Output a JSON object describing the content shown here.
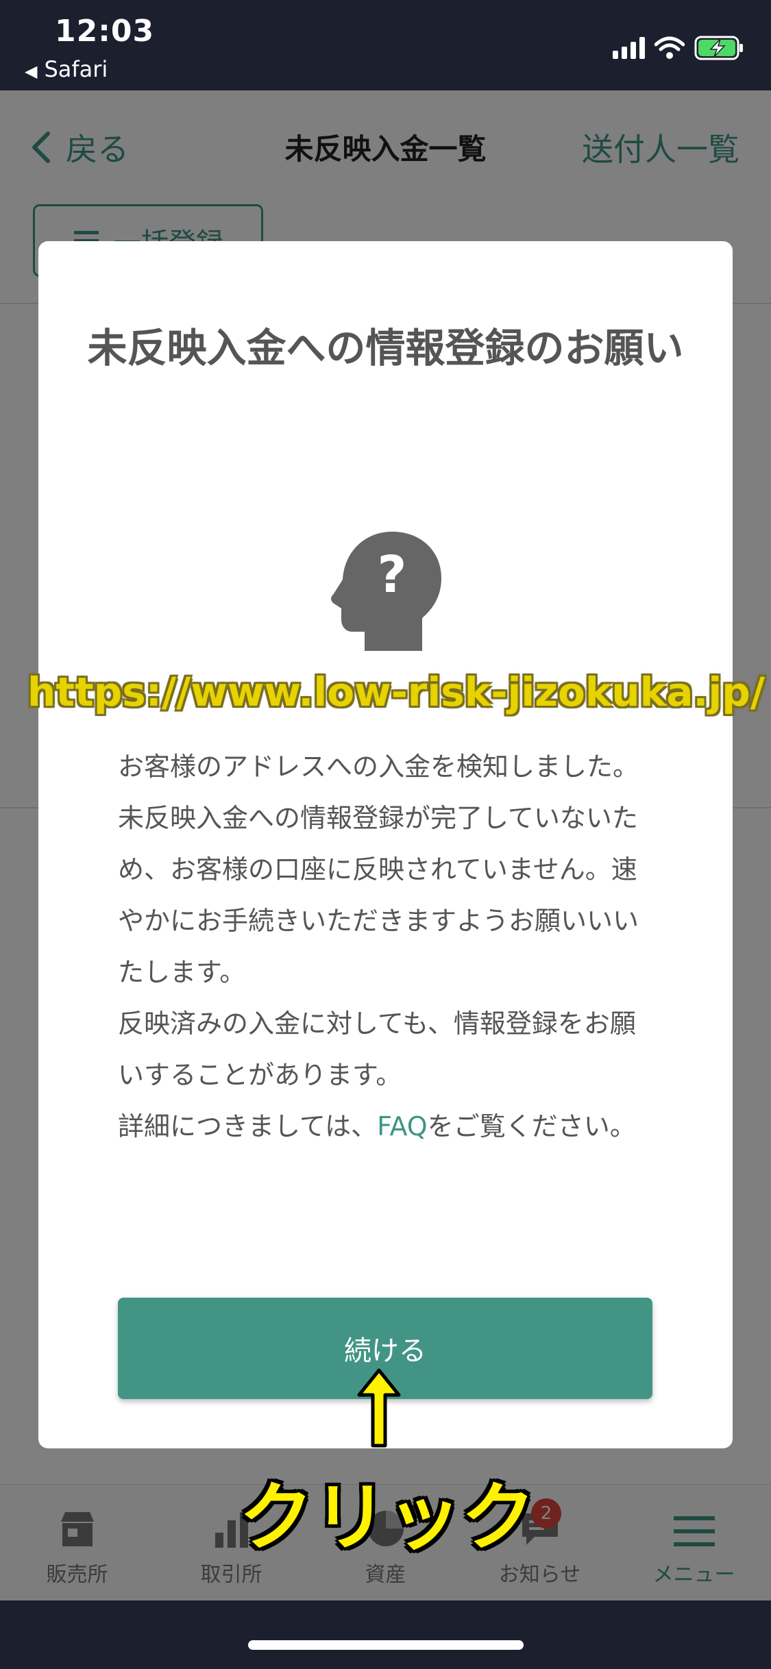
{
  "status_bar": {
    "time": "12:03",
    "back_app": "Safari",
    "back_glyph": "◀"
  },
  "nav": {
    "back_label": "戻る",
    "title": "未反映入金一覧",
    "right_label": "送付人一覧"
  },
  "bulk_register_button": {
    "label": "一括登録"
  },
  "modal": {
    "title": "未反映入金への情報登録のお願い",
    "icon": "head-question-icon",
    "body_paragraphs": [
      "お客様のアドレスへの入金を検知しました。",
      "未反映入金への情報登録が完了していないため、お客様の口座に反映されていません。速やかにお手続きいただきますようお願いいいたします。",
      "反映済みの入金に対しても、情報登録をお願いすることがあります。"
    ],
    "faq_prefix": "詳細につきましては、",
    "faq_link": "FAQ",
    "faq_suffix": "をご覧ください。",
    "continue_label": "続ける"
  },
  "tab_bar": {
    "items": [
      {
        "label": "販売所",
        "icon": "store-icon"
      },
      {
        "label": "取引所",
        "icon": "bar-chart-icon"
      },
      {
        "label": "資産",
        "icon": "pie-chart-icon"
      },
      {
        "label": "お知らせ",
        "icon": "chat-bubble-icon",
        "badge": "2"
      },
      {
        "label": "メニュー",
        "icon": "hamburger-menu-icon"
      }
    ]
  },
  "annotations": {
    "watermark_url": "https://www.low-risk-jizokuka.jp/",
    "arrow_glyph": "↑",
    "click_label": "クリック"
  },
  "colors": {
    "accent": "#3e9584",
    "button": "#429585",
    "status_bar_bg": "#1c1f2e",
    "badge": "#e0473a",
    "annotation_yellow": "#fff200"
  }
}
